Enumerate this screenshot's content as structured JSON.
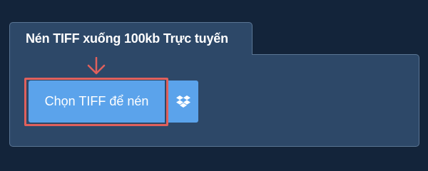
{
  "panel": {
    "tab_title": "Nén TIFF xuống 100kb Trực tuyến"
  },
  "upload": {
    "choose_label": "Chọn TIFF để nén",
    "dropbox_icon": "dropbox-icon",
    "pointer_icon": "arrow-down-icon"
  },
  "colors": {
    "background": "#13243a",
    "panel": "#2d4868",
    "button": "#5ba3eb",
    "highlight": "#e0605c"
  }
}
